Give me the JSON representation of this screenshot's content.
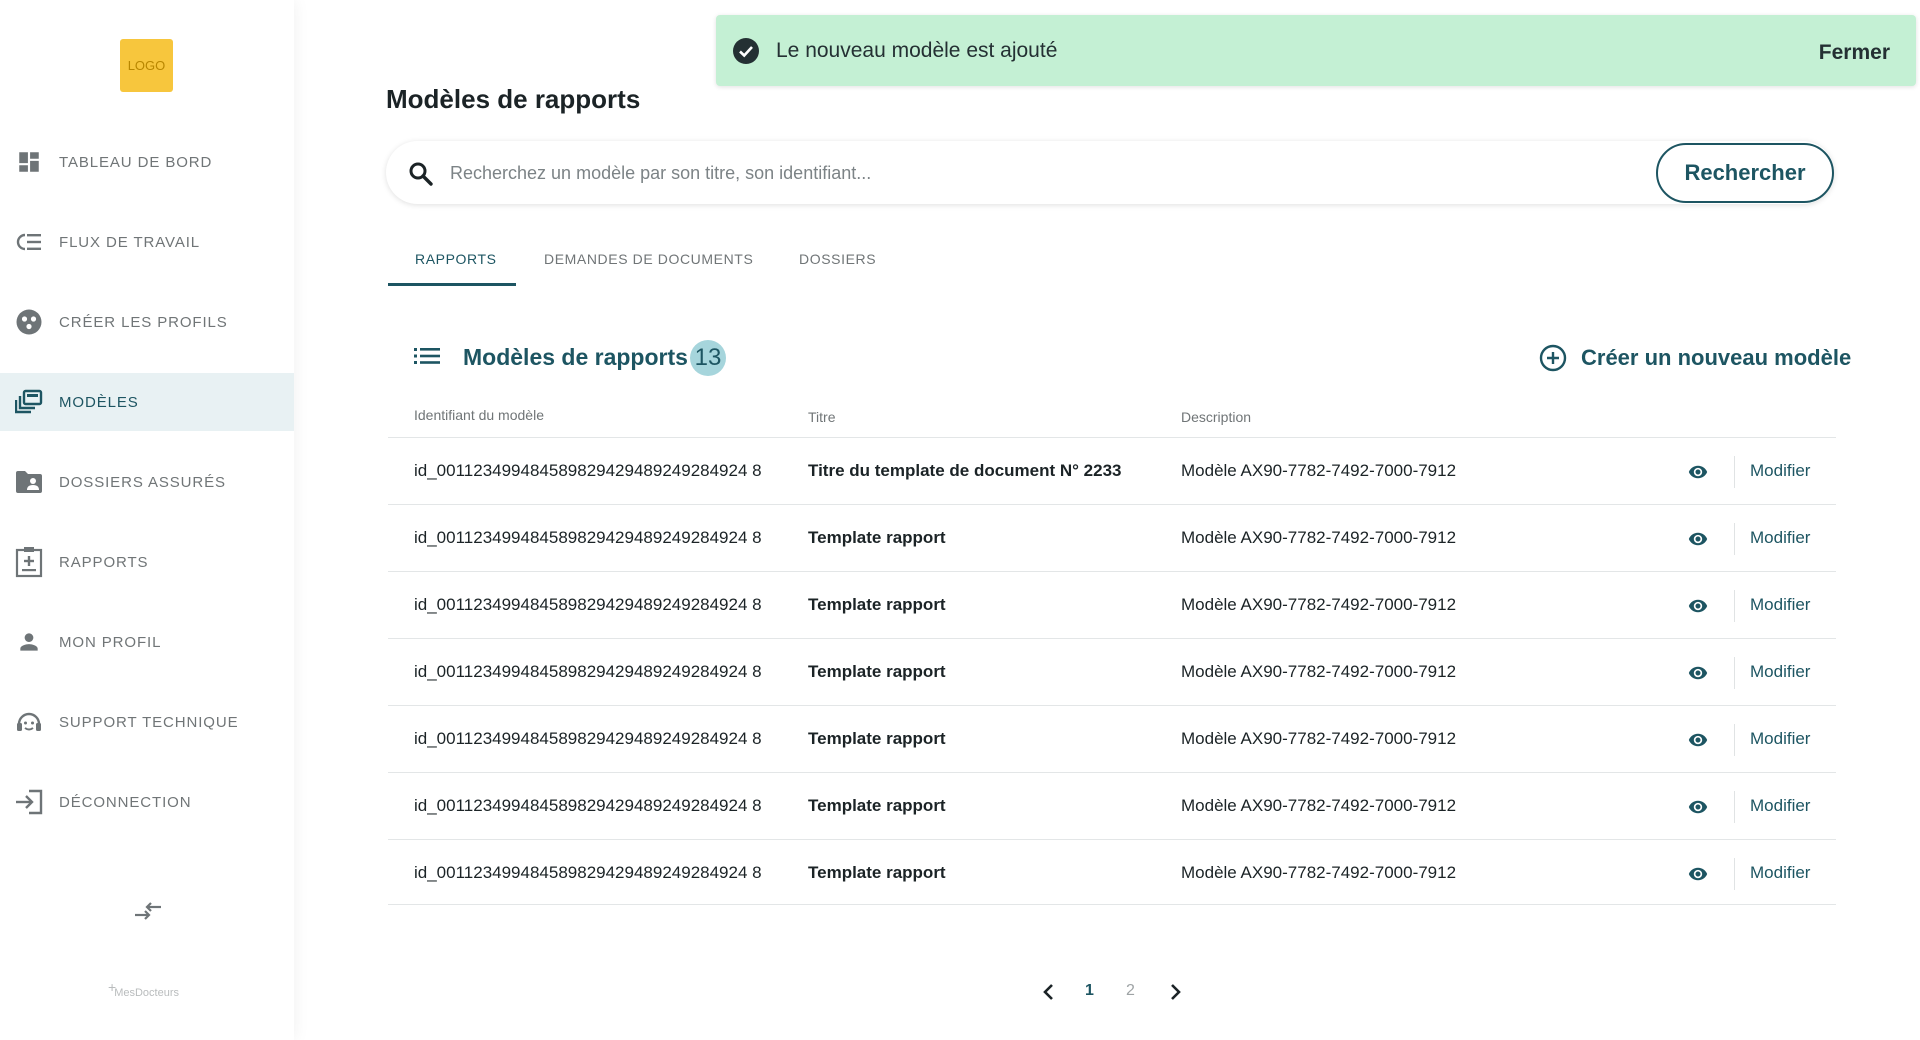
{
  "logo": {
    "label": "LOGO",
    "color": "#f7c63d"
  },
  "sidebar": {
    "items": [
      {
        "label": "TABLEAU DE BORD",
        "icon": "dashboard-icon"
      },
      {
        "label": "FLUX DE TRAVAIL",
        "icon": "workflow-icon"
      },
      {
        "label": "CRÉER LES PROFILS",
        "icon": "profiles-icon"
      },
      {
        "label": "MODÈLES",
        "icon": "templates-icon",
        "active": true
      },
      {
        "label": "DOSSIERS ASSURÉS",
        "icon": "folder-user-icon"
      },
      {
        "label": "RAPPORTS",
        "icon": "report-icon"
      },
      {
        "label": "MON PROFIL",
        "icon": "person-icon"
      },
      {
        "label": "SUPPORT TECHNIQUE",
        "icon": "support-icon"
      },
      {
        "label": "DÉCONNECTION",
        "icon": "logout-icon"
      }
    ],
    "collapse_icon": "swap-arrows-icon",
    "brand": "MesDocteurs"
  },
  "toast": {
    "message": "Le nouveau modèle est ajouté",
    "close_label": "Fermer",
    "icon": "check-circle-icon",
    "color": "#c4f0d4"
  },
  "page_title": "Modèles de rapports",
  "search": {
    "placeholder": "Recherchez un modèle par son titre, son identifiant...",
    "value": "",
    "button_label": "Rechercher"
  },
  "tabs": [
    {
      "label": "RAPPORTS",
      "active": true
    },
    {
      "label": "DEMANDES DE DOCUMENTS"
    },
    {
      "label": "DOSSIERS"
    }
  ],
  "section": {
    "title": "Modèles de rapports",
    "count": "13",
    "create_label": "Créer un nouveau modèle"
  },
  "table": {
    "columns": [
      "Identifiant du modèle",
      "Titre",
      "Description"
    ],
    "edit_label": "Modifier",
    "rows": [
      {
        "id": "id_001123499484589829429489249284924 8",
        "title": "Titre du template de document N° 2233",
        "description": "Modèle AX90-7782-7492-7000-7912"
      },
      {
        "id": "id_001123499484589829429489249284924 8",
        "title": "Template rapport",
        "description": "Modèle AX90-7782-7492-7000-7912"
      },
      {
        "id": "id_001123499484589829429489249284924 8",
        "title": "Template rapport",
        "description": "Modèle AX90-7782-7492-7000-7912"
      },
      {
        "id": "id_001123499484589829429489249284924 8",
        "title": "Template rapport",
        "description": "Modèle AX90-7782-7492-7000-7912"
      },
      {
        "id": "id_001123499484589829429489249284924 8",
        "title": "Template rapport",
        "description": "Modèle AX90-7782-7492-7000-7912"
      },
      {
        "id": "id_001123499484589829429489249284924 8",
        "title": "Template rapport",
        "description": "Modèle AX90-7782-7492-7000-7912"
      },
      {
        "id": "id_001123499484589829429489249284924 8",
        "title": "Template rapport",
        "description": "Modèle AX90-7782-7492-7000-7912"
      }
    ]
  },
  "pagination": {
    "pages": [
      "1",
      "2"
    ],
    "current": "1"
  },
  "colors": {
    "accent": "#1d5562",
    "badge": "#a6d5dc"
  }
}
